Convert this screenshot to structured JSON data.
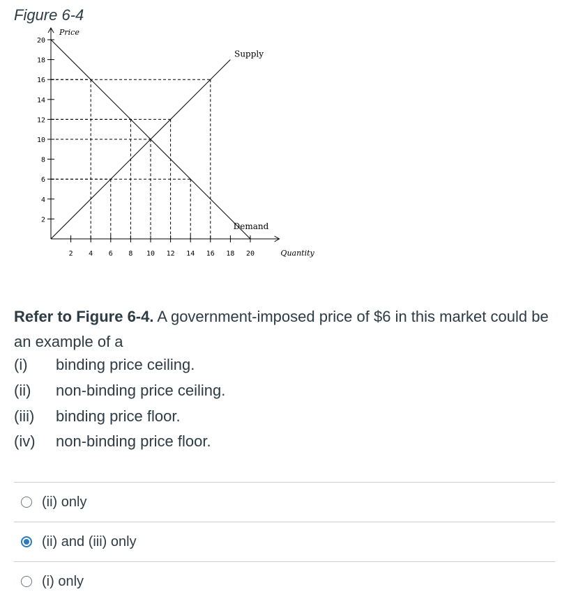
{
  "figure": {
    "title": "Figure 6-4"
  },
  "chart_data": {
    "type": "line",
    "title": "Figure 6-4",
    "xlabel": "Quantity",
    "ylabel": "Price",
    "xlim": [
      0,
      22
    ],
    "ylim": [
      0,
      20
    ],
    "x_ticks": [
      2,
      4,
      6,
      8,
      10,
      12,
      14,
      16,
      18,
      20
    ],
    "y_ticks": [
      2,
      4,
      6,
      8,
      10,
      12,
      14,
      16,
      18,
      20
    ],
    "grid": false,
    "series": [
      {
        "name": "Supply",
        "points": [
          [
            0,
            0
          ],
          [
            18,
            18
          ]
        ]
      },
      {
        "name": "Demand",
        "points": [
          [
            0,
            20
          ],
          [
            20,
            0
          ]
        ]
      }
    ],
    "guides": [
      {
        "price": 16,
        "quantity": 16
      },
      {
        "price": 12,
        "quantity": 8
      },
      {
        "price": 10,
        "quantity": 10
      },
      {
        "price": 6,
        "quantity": 14
      },
      {
        "price": 6,
        "quantity": 6
      },
      {
        "price": 16,
        "quantity": 4
      },
      {
        "price": 12,
        "quantity": 12
      }
    ]
  },
  "question": {
    "lead": "Refer to Figure 6-4.",
    "body": " A government-imposed price of $6 in this market could be an example of a"
  },
  "statements": [
    {
      "num": "(i)",
      "text": "binding price ceiling."
    },
    {
      "num": "(ii)",
      "text": "non-binding price ceiling."
    },
    {
      "num": "(iii)",
      "text": "binding price floor."
    },
    {
      "num": "(iv)",
      "text": "non-binding price floor."
    }
  ],
  "answers": [
    {
      "label": "(ii) only",
      "selected": false
    },
    {
      "label": "(ii) and (iii) only",
      "selected": true
    },
    {
      "label": "(i) only",
      "selected": false
    }
  ]
}
